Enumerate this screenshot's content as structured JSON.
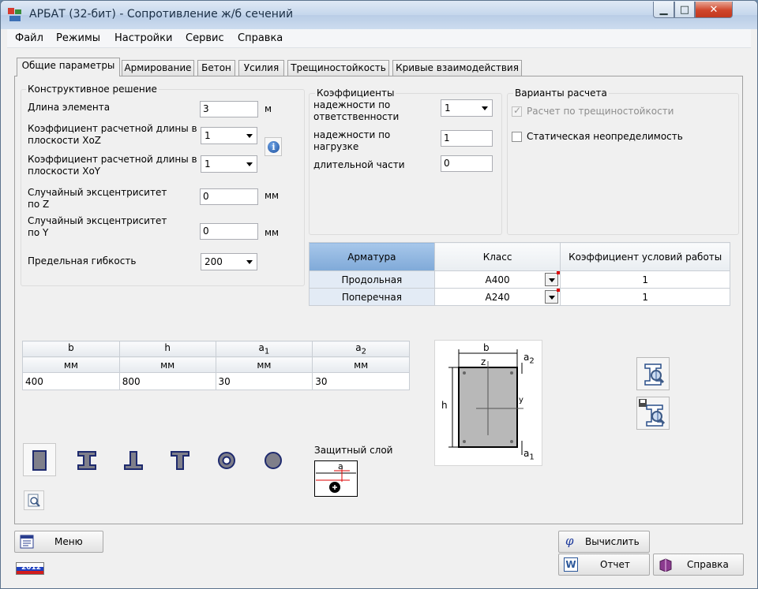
{
  "window": {
    "title": "АРБАТ (32-бит) - Сопротивление ж/б сечений",
    "min_symbol": "▁",
    "max_symbol": "□",
    "close_symbol": "✕"
  },
  "menu": [
    "Файл",
    "Режимы",
    "Настройки",
    "Сервис",
    "Справка"
  ],
  "tabs": [
    "Общие параметры",
    "Армирование",
    "Бетон",
    "Усилия",
    "Трещиностойкость",
    "Кривые взаимодействия"
  ],
  "construct": {
    "title": "Конструктивное решение",
    "length_label": "Длина элемента",
    "length_value": "3",
    "length_unit": "м",
    "kxoz_label": "Коэффициент расчетной длины в плоскости XoZ",
    "kxoz_value": "1",
    "kxoy_label": "Коэффициент расчетной длины в плоскости XoY",
    "kxoy_value": "1",
    "ecc_z_label": "Случайный эксцентриситет по Z",
    "ecc_z_value": "0",
    "ecc_z_unit": "мм",
    "ecc_y_label": "Случайный эксцентриситет по Y",
    "ecc_y_value": "0",
    "ecc_y_unit": "мм",
    "slender_label": "Предельная гибкость",
    "slender_value": "200"
  },
  "coeffs": {
    "title": "Коэффициенты",
    "resp_label": "надежности по ответственности",
    "resp_value": "1",
    "load_label": "надежности по нагрузке",
    "load_value": "1",
    "long_label": "длительной части",
    "long_value": "0"
  },
  "variants": {
    "title": "Варианты расчета",
    "crack_label": "Расчет по трещиностойкости",
    "crack_checked": true,
    "static_label": "Статическая неопределимость",
    "static_checked": false
  },
  "rebar_table": {
    "headers": [
      "Арматура",
      "Класс",
      "Коэффициент условий работы"
    ],
    "rows": [
      {
        "name": "Продольная",
        "class": "А400",
        "coef": "1"
      },
      {
        "name": "Поперечная",
        "class": "А240",
        "coef": "1"
      }
    ]
  },
  "dims_table": {
    "headers": [
      "b",
      "h",
      "a",
      "a"
    ],
    "header_subs": [
      "",
      "",
      "1",
      "2"
    ],
    "units": [
      "мм",
      "мм",
      "мм",
      "мм"
    ],
    "values": [
      "400",
      "800",
      "30",
      "30"
    ]
  },
  "cover": {
    "title": "Защитный слой",
    "label": "a"
  },
  "section": {
    "b": "b",
    "h": "h",
    "z": "z",
    "y": "y",
    "a": "a",
    "a1_sub": "1",
    "a2_sub": "2"
  },
  "buttons": {
    "menu": "Меню",
    "calc": "Вычислить",
    "report": "Отчет",
    "help": "Справка"
  },
  "flag_year": "2012",
  "icons": {
    "calc_icon": "φ",
    "report_icon": "W"
  },
  "colors": {
    "accent": "#7fa9d8",
    "close_red": "#c8432a"
  }
}
